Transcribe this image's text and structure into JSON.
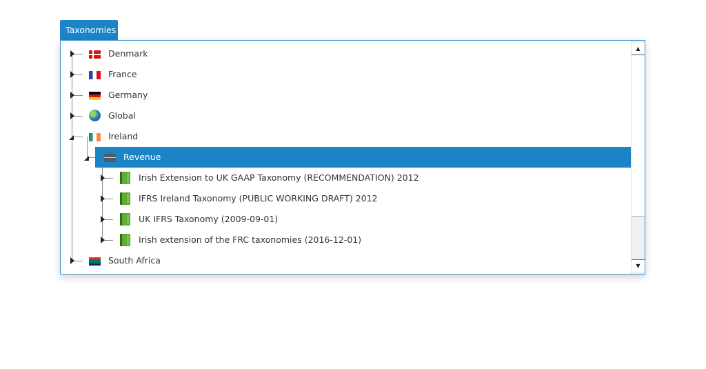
{
  "panel": {
    "tab_label": "Taxonomies"
  },
  "tree": {
    "nodes": [
      {
        "label": "Denmark",
        "icon": "flag-denmark-icon",
        "expanded": false
      },
      {
        "label": "France",
        "icon": "flag-france-icon",
        "expanded": false
      },
      {
        "label": "Germany",
        "icon": "flag-germany-icon",
        "expanded": false
      },
      {
        "label": "Global",
        "icon": "globe-icon",
        "expanded": false
      },
      {
        "label": "Ireland",
        "icon": "flag-ireland-icon",
        "expanded": true,
        "children": [
          {
            "label": "Revenue",
            "icon": "briefcase-icon",
            "expanded": true,
            "selected": true,
            "children": [
              {
                "label": "Irish Extension to UK GAAP Taxonomy (RECOMMENDATION) 2012",
                "icon": "book-icon"
              },
              {
                "label": "IFRS Ireland Taxonomy (PUBLIC WORKING DRAFT) 2012",
                "icon": "book-icon"
              },
              {
                "label": "UK IFRS Taxonomy (2009-09-01)",
                "icon": "book-icon"
              },
              {
                "label": "Irish extension of the FRC taxonomies (2016-12-01)",
                "icon": "book-icon"
              }
            ]
          }
        ]
      },
      {
        "label": "South Africa",
        "icon": "flag-south-africa-icon",
        "expanded": false
      }
    ]
  },
  "scrollbar": {
    "up_glyph": "▲",
    "down_glyph": "▼"
  },
  "colors": {
    "accent": "#1b84c7",
    "selected_text": "#ffffff",
    "text": "#333333"
  }
}
